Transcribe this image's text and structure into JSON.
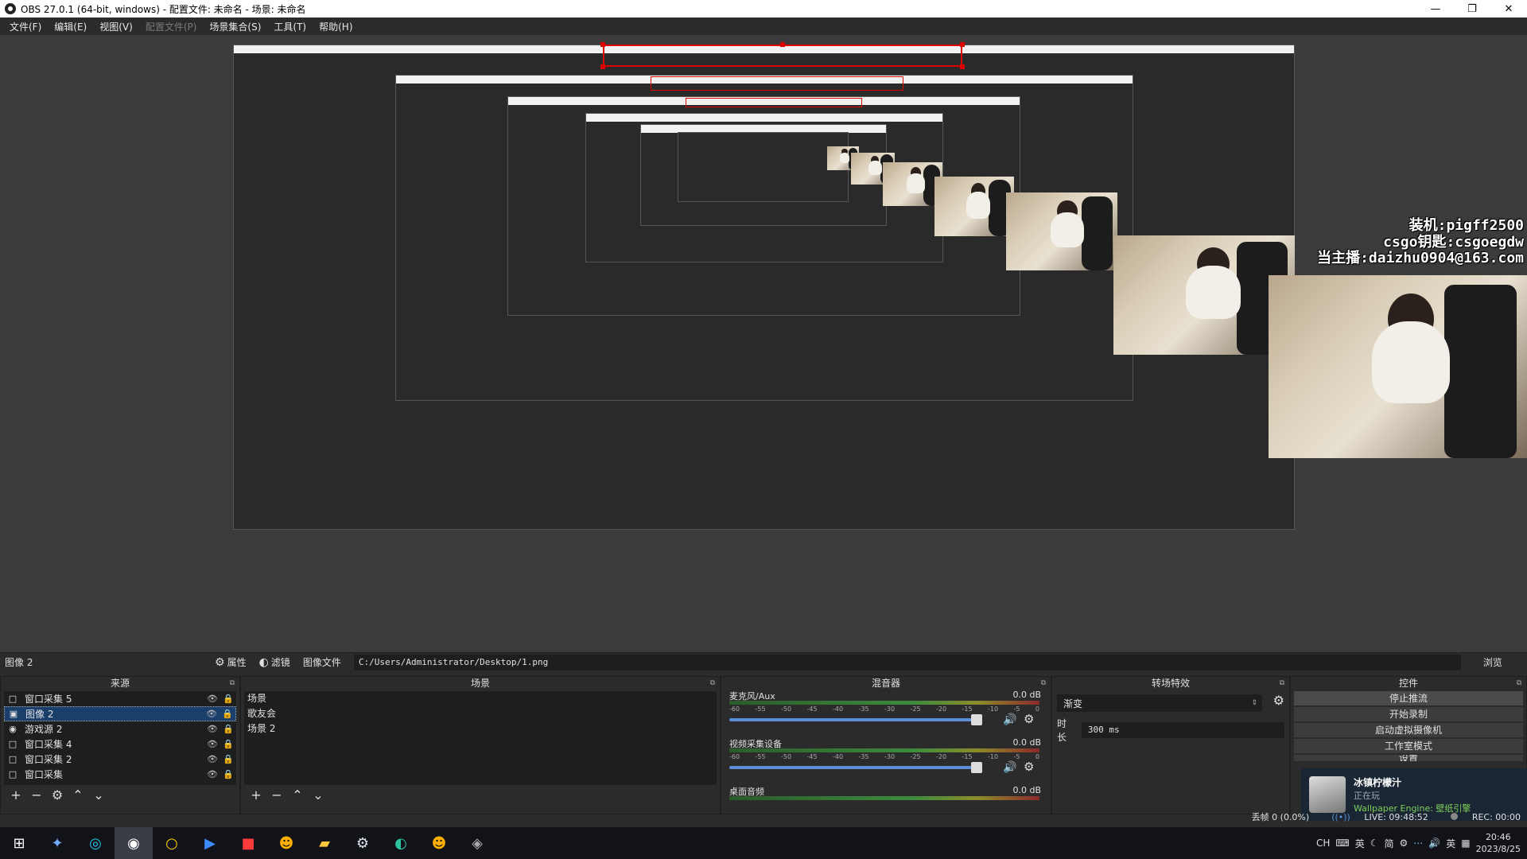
{
  "window": {
    "title": "OBS 27.0.1 (64-bit, windows) - 配置文件: 未命名 - 场景: 未命名",
    "minimize": "—",
    "maximize": "❐",
    "close": "✕"
  },
  "menu": {
    "file": "文件(F)",
    "edit": "编辑(E)",
    "view": "视图(V)",
    "profile": "配置文件(P)",
    "scene_collection": "场景集合(S)",
    "tools": "工具(T)",
    "help": "帮助(H)"
  },
  "preview": {
    "overlay_lines": [
      "装机:pigff2500",
      "csgo钥匙:csgoegdw",
      "当主播:daizhu0904@163.com"
    ]
  },
  "scenebar": {
    "current_source": "图像 2",
    "properties": "属性",
    "filters": "滤镜",
    "image_file_label": "图像文件",
    "path": "C:/Users/Administrator/Desktop/1.png",
    "browse": "浏览"
  },
  "sources": {
    "title": "来源",
    "items": [
      {
        "label": "窗口采集 5",
        "icon": "□"
      },
      {
        "label": "图像 2",
        "icon": "▣"
      },
      {
        "label": "游戏源 2",
        "icon": "◉"
      },
      {
        "label": "窗口采集 4",
        "icon": "□"
      },
      {
        "label": "窗口采集 2",
        "icon": "□"
      },
      {
        "label": "窗口采集",
        "icon": "□"
      }
    ]
  },
  "scenes": {
    "title": "场景",
    "items": [
      "场景",
      "歌友会",
      "场景 2"
    ]
  },
  "mixer": {
    "title": "混音器",
    "ticks": [
      "-60",
      "-55",
      "-50",
      "-45",
      "-40",
      "-35",
      "-30",
      "-25",
      "-20",
      "-15",
      "-10",
      "-5",
      "0"
    ],
    "channels": [
      {
        "name": "麦克风/Aux",
        "db": "0.0 dB"
      },
      {
        "name": "视频采集设备",
        "db": "0.0 dB"
      },
      {
        "name": "桌面音频",
        "db": "0.0 dB"
      }
    ]
  },
  "transitions": {
    "title": "转场特效",
    "selected": "渐变",
    "duration_label": "时长",
    "duration_value": "300 ms"
  },
  "controls": {
    "title": "控件",
    "stop_stream": "停止推流",
    "start_record": "开始录制",
    "virtual_cam": "启动虚拟摄像机",
    "studio_mode": "工作室模式",
    "settings": "设置"
  },
  "notification": {
    "name": "冰镇柠檬汁",
    "status": "正在玩",
    "game": "Wallpaper Engine: 壁纸引擎"
  },
  "status": {
    "dropped": "丢帧 0 (0.0%)",
    "live": "LIVE: 09:48:52",
    "rec": "REC: 00:00"
  },
  "taskbar": {
    "clock_time": "20:46",
    "clock_date": "2023/8/25",
    "ime": "英",
    "ime_ch": "CH",
    "ime_simplified": "简"
  },
  "colors": {
    "background": "#2b2b2b",
    "panel_dark": "#1e1e1e",
    "selection": "#1b3f6b",
    "accent_blue": "#5a8ed6",
    "recording_box": "#e00000"
  }
}
